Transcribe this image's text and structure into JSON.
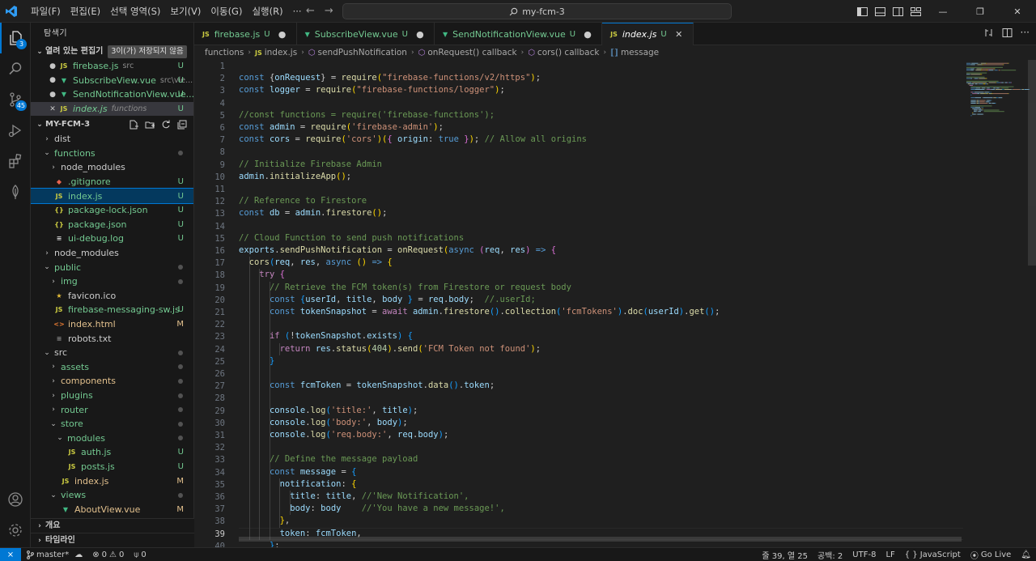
{
  "menu": [
    "파일(F)",
    "편집(E)",
    "선택 영역(S)",
    "보기(V)",
    "이동(G)",
    "실행(R)",
    "···"
  ],
  "command_center": "my-fcm-3",
  "sidebar": {
    "title": "탐색기",
    "open_editors_label": "열려 있는 편집기",
    "unsaved_tooltip": "3이(가) 저장되지 않음",
    "open_editors": [
      {
        "name": "firebase.js",
        "sub": "src",
        "status": "U",
        "icon": "JS"
      },
      {
        "name": "SubscribeView.vue",
        "sub": "src\\vie...",
        "status": "U",
        "icon": "V"
      },
      {
        "name": "SendNotificationView.vue...",
        "sub": "",
        "status": "U",
        "icon": "V"
      },
      {
        "name": "index.js",
        "sub": "functions",
        "status": "U",
        "icon": "JS"
      }
    ],
    "project_label": "MY-FCM-3",
    "tree": [
      {
        "name": "dist",
        "depth": 0,
        "type": "folder",
        "open": false
      },
      {
        "name": "functions",
        "depth": 0,
        "type": "folder",
        "open": true,
        "color": "u",
        "dot": true
      },
      {
        "name": "node_modules",
        "depth": 1,
        "type": "folder",
        "open": false
      },
      {
        "name": ".gitignore",
        "depth": 1,
        "type": "file",
        "icon": "git",
        "color": "u",
        "status": "U"
      },
      {
        "name": "index.js",
        "depth": 1,
        "type": "file",
        "icon": "JS",
        "color": "u",
        "status": "U",
        "selected": true
      },
      {
        "name": "package-lock.json",
        "depth": 1,
        "type": "file",
        "icon": "{}",
        "color": "u",
        "status": "U"
      },
      {
        "name": "package.json",
        "depth": 1,
        "type": "file",
        "icon": "{}",
        "color": "u",
        "status": "U"
      },
      {
        "name": "ui-debug.log",
        "depth": 1,
        "type": "file",
        "icon": "log",
        "color": "u",
        "status": "U"
      },
      {
        "name": "node_modules",
        "depth": 0,
        "type": "folder",
        "open": false
      },
      {
        "name": "public",
        "depth": 0,
        "type": "folder",
        "open": true,
        "color": "u",
        "dot": true
      },
      {
        "name": "img",
        "depth": 1,
        "type": "folder",
        "open": false,
        "color": "u",
        "dot": true
      },
      {
        "name": "favicon.ico",
        "depth": 1,
        "type": "file",
        "icon": "star"
      },
      {
        "name": "firebase-messaging-sw.js",
        "depth": 1,
        "type": "file",
        "icon": "JS",
        "color": "u",
        "status": "U"
      },
      {
        "name": "index.html",
        "depth": 1,
        "type": "file",
        "icon": "html",
        "color": "m",
        "status": "M"
      },
      {
        "name": "robots.txt",
        "depth": 1,
        "type": "file",
        "icon": "txt"
      },
      {
        "name": "src",
        "depth": 0,
        "type": "folder",
        "open": true,
        "dot": true
      },
      {
        "name": "assets",
        "depth": 1,
        "type": "folder",
        "open": false,
        "color": "u",
        "dot": true
      },
      {
        "name": "components",
        "depth": 1,
        "type": "folder",
        "open": false,
        "color": "m",
        "dot": true
      },
      {
        "name": "plugins",
        "depth": 1,
        "type": "folder",
        "open": false,
        "color": "u",
        "dot": true
      },
      {
        "name": "router",
        "depth": 1,
        "type": "folder",
        "open": false,
        "color": "u",
        "dot": true
      },
      {
        "name": "store",
        "depth": 1,
        "type": "folder",
        "open": true,
        "color": "u",
        "dot": true
      },
      {
        "name": "modules",
        "depth": 2,
        "type": "folder",
        "open": true,
        "color": "u",
        "dot": true
      },
      {
        "name": "auth.js",
        "depth": 3,
        "type": "file",
        "icon": "JS",
        "color": "u",
        "status": "U"
      },
      {
        "name": "posts.js",
        "depth": 3,
        "type": "file",
        "icon": "JS",
        "color": "u",
        "status": "U"
      },
      {
        "name": "index.js",
        "depth": 2,
        "type": "file",
        "icon": "JS",
        "color": "m",
        "status": "M"
      },
      {
        "name": "views",
        "depth": 1,
        "type": "folder",
        "open": true,
        "color": "u",
        "dot": true
      },
      {
        "name": "AboutView.vue",
        "depth": 2,
        "type": "file",
        "icon": "V",
        "color": "m",
        "status": "M"
      }
    ],
    "outline_label": "개요",
    "timeline_label": "타임라인"
  },
  "tabs": [
    {
      "name": "firebase.js",
      "status": "U",
      "icon": "JS",
      "dirty": true
    },
    {
      "name": "SubscribeView.vue",
      "status": "U",
      "icon": "V",
      "dirty": true
    },
    {
      "name": "SendNotificationView.vue",
      "status": "U",
      "icon": "V",
      "dirty": true
    },
    {
      "name": "index.js",
      "status": "U",
      "icon": "JS",
      "active": true
    }
  ],
  "breadcrumb": [
    "functions",
    "index.js",
    "sendPushNotification",
    "onRequest() callback",
    "cors() callback",
    "message"
  ],
  "editor": {
    "start_line": 1,
    "current_line": 39,
    "lines": [
      [],
      [
        [
          "k",
          "const "
        ],
        [
          "p",
          "{"
        ],
        [
          "v",
          "onRequest"
        ],
        [
          "p",
          "} = "
        ],
        [
          "f",
          "require"
        ],
        [
          "b1",
          "("
        ],
        [
          "s",
          "\"firebase-functions/v2/https\""
        ],
        [
          "b1",
          ")"
        ],
        [
          "p",
          ";"
        ]
      ],
      [
        [
          "k",
          "const "
        ],
        [
          "v",
          "logger"
        ],
        [
          "p",
          " = "
        ],
        [
          "f",
          "require"
        ],
        [
          "b1",
          "("
        ],
        [
          "s",
          "\"firebase-functions/logger\""
        ],
        [
          "b1",
          ")"
        ],
        [
          "p",
          ";"
        ]
      ],
      [],
      [
        [
          "cm",
          "//const functions = require('firebase-functions');"
        ]
      ],
      [
        [
          "k",
          "const "
        ],
        [
          "v",
          "admin"
        ],
        [
          "p",
          " = "
        ],
        [
          "f",
          "require"
        ],
        [
          "b1",
          "("
        ],
        [
          "s",
          "'firebase-admin'"
        ],
        [
          "b1",
          ")"
        ],
        [
          "p",
          ";"
        ]
      ],
      [
        [
          "k",
          "const "
        ],
        [
          "v",
          "cors"
        ],
        [
          "p",
          " = "
        ],
        [
          "f",
          "require"
        ],
        [
          "b1",
          "("
        ],
        [
          "s",
          "'cors'"
        ],
        [
          "b1",
          ")("
        ],
        [
          "b2",
          "{ "
        ],
        [
          "v",
          "origin"
        ],
        [
          "p",
          ": "
        ],
        [
          "k",
          "true"
        ],
        [
          "b2",
          " }"
        ],
        [
          "b1",
          ")"
        ],
        [
          "p",
          "; "
        ],
        [
          "cm",
          "// Allow all origins"
        ]
      ],
      [],
      [
        [
          "cm",
          "// Initialize Firebase Admin"
        ]
      ],
      [
        [
          "v",
          "admin"
        ],
        [
          "p",
          "."
        ],
        [
          "f",
          "initializeApp"
        ],
        [
          "b1",
          "()"
        ],
        [
          "p",
          ";"
        ]
      ],
      [],
      [
        [
          "cm",
          "// Reference to Firestore"
        ]
      ],
      [
        [
          "k",
          "const "
        ],
        [
          "v",
          "db"
        ],
        [
          "p",
          " = "
        ],
        [
          "v",
          "admin"
        ],
        [
          "p",
          "."
        ],
        [
          "f",
          "firestore"
        ],
        [
          "b1",
          "()"
        ],
        [
          "p",
          ";"
        ]
      ],
      [],
      [
        [
          "cm",
          "// Cloud Function to send push notifications"
        ]
      ],
      [
        [
          "v",
          "exports"
        ],
        [
          "p",
          "."
        ],
        [
          "f",
          "sendPushNotification"
        ],
        [
          "p",
          " = "
        ],
        [
          "f",
          "onRequest"
        ],
        [
          "b1",
          "("
        ],
        [
          "k",
          "async "
        ],
        [
          "b2",
          "("
        ],
        [
          "v",
          "req"
        ],
        [
          "p",
          ", "
        ],
        [
          "v",
          "res"
        ],
        [
          "b2",
          ")"
        ],
        [
          "k",
          " => "
        ],
        [
          "b2",
          "{"
        ]
      ],
      [
        [
          "p",
          "  "
        ],
        [
          "f",
          "cors"
        ],
        [
          "b3",
          "("
        ],
        [
          "v",
          "req"
        ],
        [
          "p",
          ", "
        ],
        [
          "v",
          "res"
        ],
        [
          "p",
          ", "
        ],
        [
          "k",
          "async "
        ],
        [
          "b1",
          "() "
        ],
        [
          "k",
          "=> "
        ],
        [
          "b1",
          "{"
        ]
      ],
      [
        [
          "p",
          "    "
        ],
        [
          "kc",
          "try "
        ],
        [
          "b2",
          "{"
        ]
      ],
      [
        [
          "p",
          "      "
        ],
        [
          "cm",
          "// Retrieve the FCM token(s) from Firestore or request body"
        ]
      ],
      [
        [
          "p",
          "      "
        ],
        [
          "k",
          "const "
        ],
        [
          "b3",
          "{"
        ],
        [
          "v",
          "userId"
        ],
        [
          "p",
          ", "
        ],
        [
          "v",
          "title"
        ],
        [
          "p",
          ", "
        ],
        [
          "v",
          "body"
        ],
        [
          "b3",
          " }"
        ],
        [
          "p",
          " = "
        ],
        [
          "v",
          "req"
        ],
        [
          "p",
          "."
        ],
        [
          "v",
          "body"
        ],
        [
          "p",
          ";  "
        ],
        [
          "cm",
          "//.userId;"
        ]
      ],
      [
        [
          "p",
          "      "
        ],
        [
          "k",
          "const "
        ],
        [
          "v",
          "tokenSnapshot"
        ],
        [
          "p",
          " = "
        ],
        [
          "kc",
          "await "
        ],
        [
          "v",
          "admin"
        ],
        [
          "p",
          "."
        ],
        [
          "f",
          "firestore"
        ],
        [
          "b3",
          "()"
        ],
        [
          "p",
          "."
        ],
        [
          "f",
          "collection"
        ],
        [
          "b3",
          "("
        ],
        [
          "s",
          "'fcmTokens'"
        ],
        [
          "b3",
          ")"
        ],
        [
          "p",
          "."
        ],
        [
          "f",
          "doc"
        ],
        [
          "b3",
          "("
        ],
        [
          "v",
          "userId"
        ],
        [
          "b3",
          ")"
        ],
        [
          "p",
          "."
        ],
        [
          "f",
          "get"
        ],
        [
          "b3",
          "()"
        ],
        [
          "p",
          ";"
        ]
      ],
      [],
      [
        [
          "p",
          "      "
        ],
        [
          "kc",
          "if "
        ],
        [
          "b3",
          "("
        ],
        [
          "p",
          "!"
        ],
        [
          "v",
          "tokenSnapshot"
        ],
        [
          "p",
          "."
        ],
        [
          "v",
          "exists"
        ],
        [
          "b3",
          ")"
        ],
        [
          "p",
          " "
        ],
        [
          "b3",
          "{"
        ]
      ],
      [
        [
          "p",
          "        "
        ],
        [
          "kc",
          "return "
        ],
        [
          "v",
          "res"
        ],
        [
          "p",
          "."
        ],
        [
          "f",
          "status"
        ],
        [
          "b1",
          "("
        ],
        [
          "n",
          "404"
        ],
        [
          "b1",
          ")"
        ],
        [
          "p",
          "."
        ],
        [
          "f",
          "send"
        ],
        [
          "b1",
          "("
        ],
        [
          "s",
          "'FCM Token not found'"
        ],
        [
          "b1",
          ")"
        ],
        [
          "p",
          ";"
        ]
      ],
      [
        [
          "p",
          "      "
        ],
        [
          "b3",
          "}"
        ]
      ],
      [],
      [
        [
          "p",
          "      "
        ],
        [
          "k",
          "const "
        ],
        [
          "v",
          "fcmToken"
        ],
        [
          "p",
          " = "
        ],
        [
          "v",
          "tokenSnapshot"
        ],
        [
          "p",
          "."
        ],
        [
          "f",
          "data"
        ],
        [
          "b3",
          "()"
        ],
        [
          "p",
          "."
        ],
        [
          "v",
          "token"
        ],
        [
          "p",
          ";"
        ]
      ],
      [],
      [
        [
          "p",
          "      "
        ],
        [
          "v",
          "console"
        ],
        [
          "p",
          "."
        ],
        [
          "f",
          "log"
        ],
        [
          "b3",
          "("
        ],
        [
          "s",
          "'title:'"
        ],
        [
          "p",
          ", "
        ],
        [
          "v",
          "title"
        ],
        [
          "b3",
          ")"
        ],
        [
          "p",
          ";"
        ]
      ],
      [
        [
          "p",
          "      "
        ],
        [
          "v",
          "console"
        ],
        [
          "p",
          "."
        ],
        [
          "f",
          "log"
        ],
        [
          "b3",
          "("
        ],
        [
          "s",
          "'body:'"
        ],
        [
          "p",
          ", "
        ],
        [
          "v",
          "body"
        ],
        [
          "b3",
          ")"
        ],
        [
          "p",
          ";"
        ]
      ],
      [
        [
          "p",
          "      "
        ],
        [
          "v",
          "console"
        ],
        [
          "p",
          "."
        ],
        [
          "f",
          "log"
        ],
        [
          "b3",
          "("
        ],
        [
          "s",
          "'req.body:'"
        ],
        [
          "p",
          ", "
        ],
        [
          "v",
          "req"
        ],
        [
          "p",
          "."
        ],
        [
          "v",
          "body"
        ],
        [
          "b3",
          ")"
        ],
        [
          "p",
          ";"
        ]
      ],
      [],
      [
        [
          "p",
          "      "
        ],
        [
          "cm",
          "// Define the message payload"
        ]
      ],
      [
        [
          "p",
          "      "
        ],
        [
          "k",
          "const "
        ],
        [
          "v",
          "message"
        ],
        [
          "p",
          " = "
        ],
        [
          "b3",
          "{"
        ]
      ],
      [
        [
          "p",
          "        "
        ],
        [
          "v",
          "notification"
        ],
        [
          "p",
          ": "
        ],
        [
          "b1",
          "{"
        ]
      ],
      [
        [
          "p",
          "          "
        ],
        [
          "v",
          "title"
        ],
        [
          "p",
          ": "
        ],
        [
          "v",
          "title"
        ],
        [
          "p",
          ", "
        ],
        [
          "cm",
          "//'New Notification',"
        ]
      ],
      [
        [
          "p",
          "          "
        ],
        [
          "v",
          "body"
        ],
        [
          "p",
          ": "
        ],
        [
          "v",
          "body"
        ],
        [
          "p",
          "    "
        ],
        [
          "cm",
          "//'You have a new message!',"
        ]
      ],
      [
        [
          "p",
          "        "
        ],
        [
          "b1",
          "}"
        ],
        [
          "p",
          ","
        ]
      ],
      [
        [
          "p",
          "        "
        ],
        [
          "v",
          "token"
        ],
        [
          "p",
          ": "
        ],
        [
          "v",
          "fcmToken"
        ],
        [
          "p",
          ","
        ]
      ],
      [
        [
          "p",
          "      "
        ],
        [
          "b3",
          "}"
        ],
        [
          "p",
          ";"
        ]
      ]
    ]
  },
  "statusbar": {
    "branch": "master*",
    "errors": "0",
    "warnings": "0",
    "ports": "0",
    "cursor": "줄 39, 열 25",
    "indent": "공백: 2",
    "encoding": "UTF-8",
    "eol": "LF",
    "language_braces": "{ }",
    "language": "JavaScript",
    "golive": "Go Live"
  },
  "badges": {
    "explorer": "3",
    "scm": "45"
  },
  "colors": {
    "accent": "#0078d4",
    "untracked": "#73c991",
    "modified": "#e2c08d"
  }
}
